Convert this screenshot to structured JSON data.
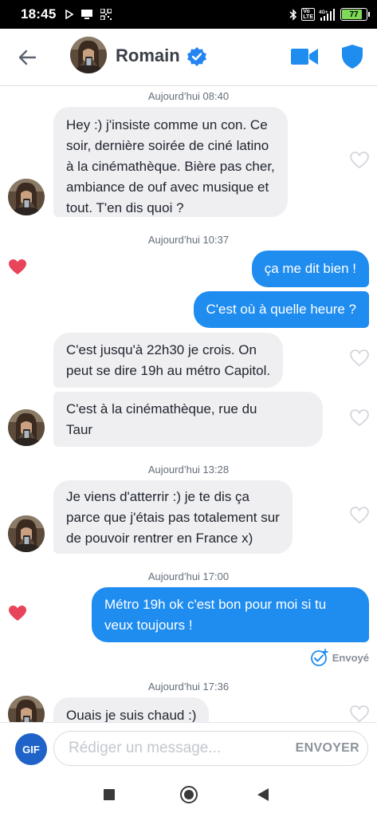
{
  "status_bar": {
    "time": "18:45",
    "battery": "77",
    "icons": [
      "play-store-icon",
      "notification-icon",
      "qr-code-icon",
      "bluetooth-icon",
      "volte-icon",
      "4g-signal-icon",
      "battery-icon"
    ]
  },
  "header": {
    "contact_name": "Romain",
    "icons": [
      "back-arrow-icon",
      "avatar",
      "verified-badge-icon",
      "video-camera-icon",
      "shield-icon"
    ]
  },
  "colors": {
    "accent": "#1f8cf0",
    "incoming_bubble": "#efeff2",
    "like_red": "#e8445a",
    "gif_button": "#1f63c9"
  },
  "messages": {
    "ts1": "Aujourd’hui 08:40",
    "m1": [
      "Hey :) j'insiste comme un con. Ce",
      "soir, dernière soirée de ciné latino",
      "à la cinémathèque. Bière pas cher,",
      "ambiance de ouf avec musique et",
      "tout. T'en dis quoi ?"
    ],
    "ts2": "Aujourd’hui 10:37",
    "m2": [
      "ça me dit bien !"
    ],
    "m3": [
      "C'est où à quelle heure ?"
    ],
    "m4": [
      "C'est jusqu'à 22h30 je crois. On",
      "peut se dire 19h au métro Capitol."
    ],
    "m5": [
      "C'est à la cinémathèque, rue du",
      "Taur"
    ],
    "ts3": "Aujourd’hui 13:28",
    "m6": [
      "Je viens d'atterrir :) je te dis ça",
      "parce que j'étais pas totalement sur",
      "de pouvoir rentrer en France x)"
    ],
    "ts4": "Aujourd’hui 17:00",
    "m7": [
      "Métro 19h ok c'est bon pour moi si tu",
      "veux toujours !"
    ],
    "sent_status": "Envoyé",
    "ts5": "Aujourd’hui 17:36",
    "m8": [
      "Ouais je suis chaud :)"
    ]
  },
  "composer": {
    "gif_label": "GIF",
    "placeholder": "Rédiger un message...",
    "send_label": "ENVOYER"
  },
  "nav_bar": {
    "icons": [
      "recents-square-icon",
      "home-circle-icon",
      "back-triangle-icon"
    ]
  }
}
